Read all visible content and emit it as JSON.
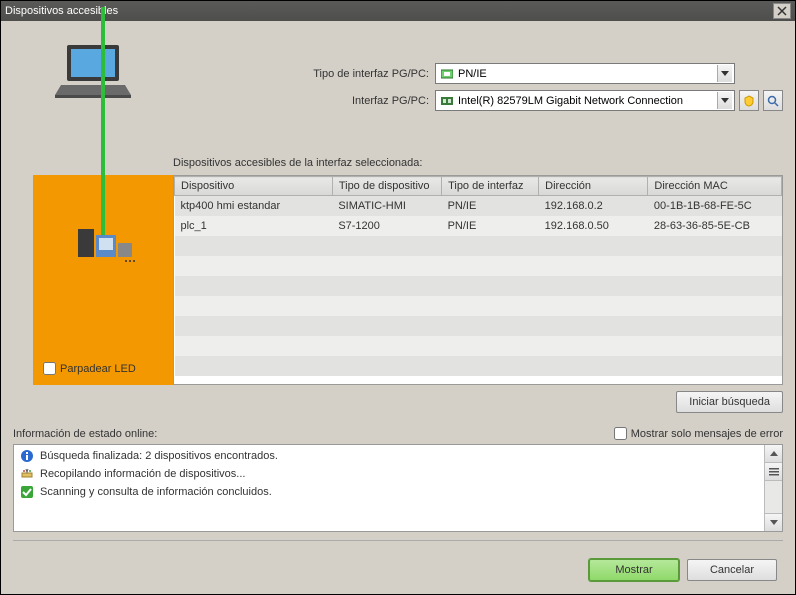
{
  "window": {
    "title": "Dispositivos accesibles"
  },
  "interface": {
    "type_label": "Tipo de interfaz PG/PC:",
    "type_value": "PN/IE",
    "iface_label": "Interfaz PG/PC:",
    "iface_value": "Intel(R) 82579LM Gigabit Network Connection"
  },
  "table": {
    "caption": "Dispositivos accesibles de la interfaz seleccionada:",
    "headers": [
      "Dispositivo",
      "Tipo de dispositivo",
      "Tipo de interfaz",
      "Dirección",
      "Dirección MAC"
    ],
    "rows": [
      {
        "device": "ktp400 hmi estandar",
        "devtype": "SIMATIC-HMI",
        "iftype": "PN/IE",
        "addr": "192.168.0.2",
        "mac": "00-1B-1B-68-FE-5C"
      },
      {
        "device": "plc_1",
        "devtype": "S7-1200",
        "iftype": "PN/IE",
        "addr": "192.168.0.50",
        "mac": "28-63-36-85-5E-CB"
      }
    ]
  },
  "flash_led_label": "Parpadear LED",
  "start_search_label": "Iniciar búsqueda",
  "status": {
    "header": "Información de estado online:",
    "errors_only_label": "Mostrar solo mensajes de error",
    "lines": [
      {
        "icon": "info",
        "text": "Búsqueda finalizada: 2 dispositivos encontrados."
      },
      {
        "icon": "work",
        "text": "Recopilando información de dispositivos..."
      },
      {
        "icon": "ok",
        "text": "Scanning y consulta de información concluidos."
      }
    ]
  },
  "footer": {
    "show": "Mostrar",
    "cancel": "Cancelar"
  }
}
